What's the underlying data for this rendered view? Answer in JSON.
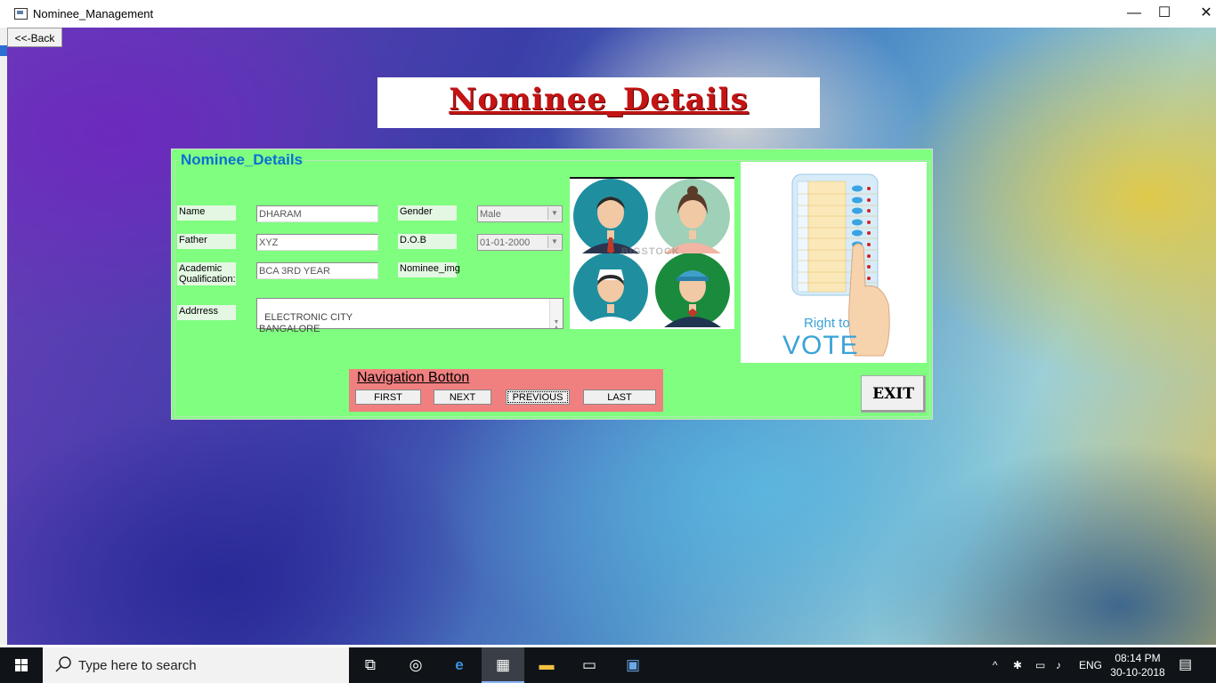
{
  "window": {
    "title": "Nominee_Management",
    "minimize": "—",
    "maximize": "☐",
    "close": "✕"
  },
  "back_button": {
    "label": "<<-Back"
  },
  "banner": {
    "title": "Nominee_Details"
  },
  "form": {
    "group_title": "Nominee_Details",
    "labels": {
      "name": "Name",
      "father": "Father",
      "academic": "Academic\nQualification:",
      "address": "Addrress",
      "gender": "Gender",
      "dob": "D.O.B",
      "nominee_img": "Nominee_img"
    },
    "values": {
      "name": "DHARAM",
      "father": "XYZ",
      "academic": "BCA 3RD YEAR",
      "address": "ELECTRONIC CITY\nBANGALORE",
      "gender": "Male",
      "dob": "01-01-2000"
    }
  },
  "vote_image": {
    "caption_small": "Right to",
    "caption_big": "VOTE"
  },
  "people_image": {
    "watermark": "BIGSTOCK"
  },
  "navigation": {
    "title": "Navigation Botton",
    "buttons": [
      "FIRST",
      "NEXT",
      "PREVIOUS",
      "LAST"
    ]
  },
  "exit_button": {
    "label": "EXIT"
  },
  "taskbar": {
    "search_placeholder": "Type here to search",
    "language": "ENG",
    "time": "08:14 PM",
    "date": "30-10-2018"
  }
}
